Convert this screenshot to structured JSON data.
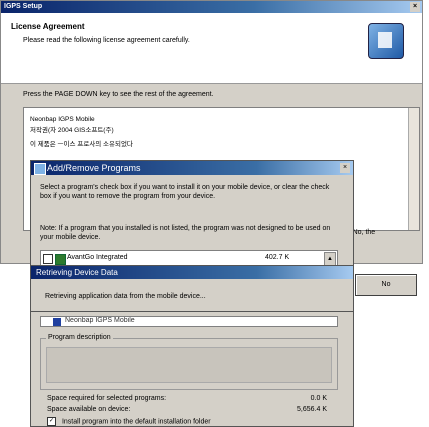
{
  "main_window": {
    "title": "IGPS Setup",
    "close_glyph": "×",
    "header_title": "License Agreement",
    "header_subtitle": "Please read the following license agreement carefully.",
    "instruction": "Press the PAGE DOWN key to see the rest of the agreement.",
    "license_lines": [
      "Neonbap IGPS Mobile",
      "저작권(자 2004 GIS소프트(주)",
      "이 제품은 ㅡ이스 프로사의 소유되었다"
    ],
    "partial_right_text": "one No, the",
    "back_button": "",
    "no_button": "No"
  },
  "add_remove": {
    "title": "Add/Remove Programs",
    "close_glyph": "×",
    "instructions": "Select a program's check box if you want to install it on your mobile device, or clear the check box if you want to remove the program from your device.",
    "note": "Note: If a program that you installed is not listed, the program was not designed to be used on your mobile device.",
    "programs": [
      {
        "name": "AvantGo Integrated",
        "size": "402.7 K",
        "checked": false
      },
      {
        "name": "Neonbap IGPS Mobile",
        "size": "",
        "checked": true
      }
    ],
    "scroll_glyph": "▲",
    "description_label": "Program description",
    "space_required_label": "Space required for selected programs:",
    "space_required_value": "0.0 K",
    "space_available_label": "Space available on device:",
    "space_available_value": "5,656.4 K",
    "install_default_label": "Install program into the default installation folder",
    "install_default_checked": true,
    "check_glyph": "✓"
  },
  "retrieving": {
    "title": "Retrieving Device Data",
    "message": "Retrieving application data from the mobile device..."
  }
}
